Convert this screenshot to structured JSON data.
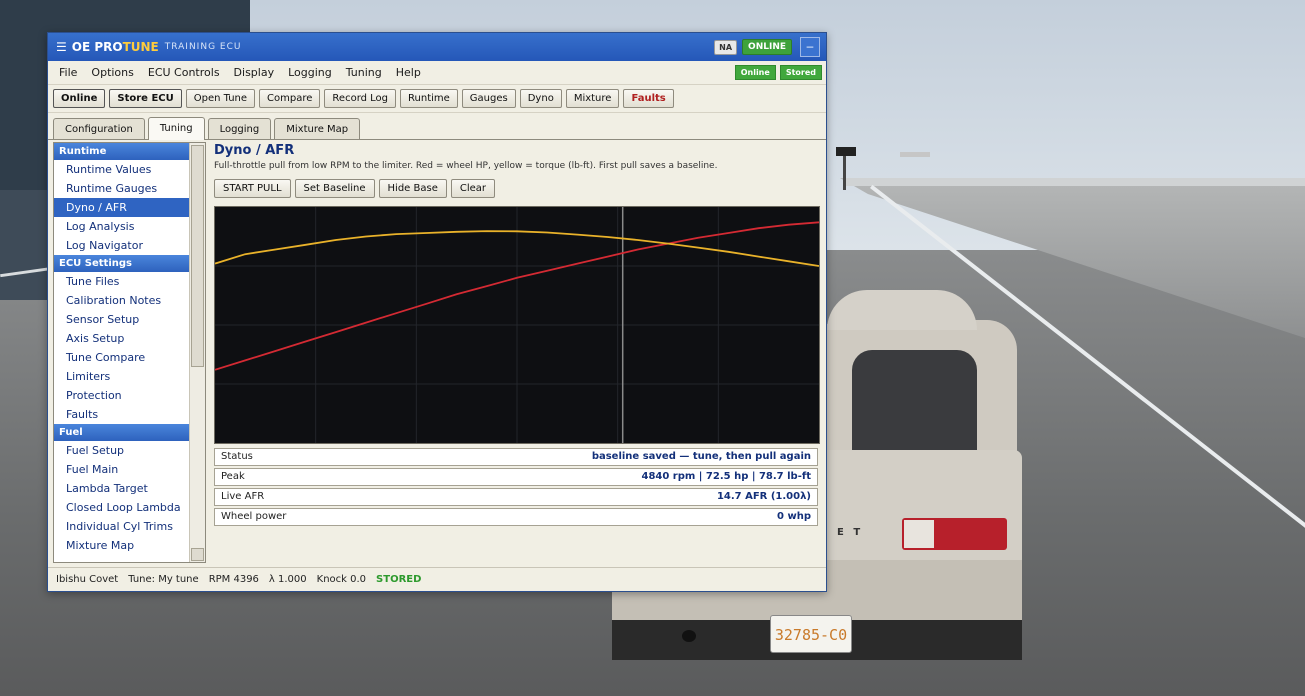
{
  "scene": {
    "plate_text": "32785-C0",
    "car_badge": "E T"
  },
  "window": {
    "title_prefix": "OE PRO",
    "title_accent": "TUNE",
    "title_sub": "TRAINING ECU",
    "badge_na": "NA",
    "badge_online": "ONLINE",
    "minimize_glyph": "–"
  },
  "menu": {
    "items": [
      "File",
      "Options",
      "ECU Controls",
      "Display",
      "Logging",
      "Tuning",
      "Help"
    ],
    "status_online": "Online",
    "status_stored": "Stored"
  },
  "toolbar": {
    "buttons": [
      "Online",
      "Store ECU",
      "Open Tune",
      "Compare",
      "Record Log",
      "Runtime",
      "Gauges",
      "Dyno",
      "Mixture",
      "Faults"
    ]
  },
  "tabs": [
    "Configuration",
    "Tuning",
    "Logging",
    "Mixture Map"
  ],
  "sidebar": {
    "sections": [
      {
        "title": "Runtime",
        "items": [
          "Runtime Values",
          "Runtime Gauges",
          "Dyno / AFR",
          "Log Analysis",
          "Log Navigator"
        ]
      },
      {
        "title": "ECU Settings",
        "items": [
          "Tune Files",
          "Calibration Notes",
          "Sensor Setup",
          "Axis Setup",
          "Tune Compare",
          "Limiters",
          "Protection",
          "Faults"
        ]
      },
      {
        "title": "Fuel",
        "items": [
          "Fuel Setup",
          "Fuel Main",
          "Lambda Target",
          "Closed Loop Lambda",
          "Individual Cyl Trims",
          "Mixture Map"
        ]
      }
    ],
    "active_item": "Dyno / AFR"
  },
  "panel": {
    "title": "Dyno / AFR",
    "description": "Full-throttle pull from low RPM to the limiter. Red = wheel HP, yellow = torque (lb-ft). First pull saves a baseline.",
    "actions": [
      "START PULL",
      "Set Baseline",
      "Hide Base",
      "Clear"
    ]
  },
  "chart_data": {
    "type": "line",
    "title": "",
    "xlabel": "",
    "ylabel": "",
    "x": [
      0,
      5,
      10,
      15,
      20,
      25,
      30,
      35,
      40,
      45,
      50,
      55,
      60,
      65,
      70,
      75,
      80,
      85,
      90,
      95,
      100
    ],
    "xlim": [
      0,
      100
    ],
    "ylim": [
      0,
      100
    ],
    "cursor_x": 67.5,
    "grid": true,
    "series": [
      {
        "color": "#d42a33",
        "values": [
          31,
          35,
          39,
          43,
          47,
          51,
          55,
          59,
          63,
          66.5,
          70,
          73,
          76,
          79,
          82,
          84.5,
          87,
          89,
          91,
          92.5,
          93.5
        ]
      },
      {
        "color": "#e9b22a",
        "values": [
          76,
          80,
          82,
          84,
          86,
          87.5,
          88.5,
          89,
          89.5,
          89.8,
          89.7,
          89.2,
          88.3,
          87.3,
          86,
          84.5,
          82.8,
          81,
          79,
          77,
          75
        ]
      }
    ]
  },
  "stats": [
    {
      "label": "Status",
      "value": "baseline saved — tune, then pull again"
    },
    {
      "label": "Peak",
      "value": "4840 rpm | 72.5 hp | 78.7 lb-ft"
    },
    {
      "label": "Live AFR",
      "value": "14.7 AFR (1.00λ)"
    },
    {
      "label": "Wheel power",
      "value": "0 whp"
    }
  ],
  "statusbar": {
    "vehicle": "Ibishu Covet",
    "tune": "Tune: My tune",
    "rpm": "RPM 4396",
    "lambda": "λ 1.000",
    "knock": "Knock 0.0",
    "state": "STORED"
  }
}
